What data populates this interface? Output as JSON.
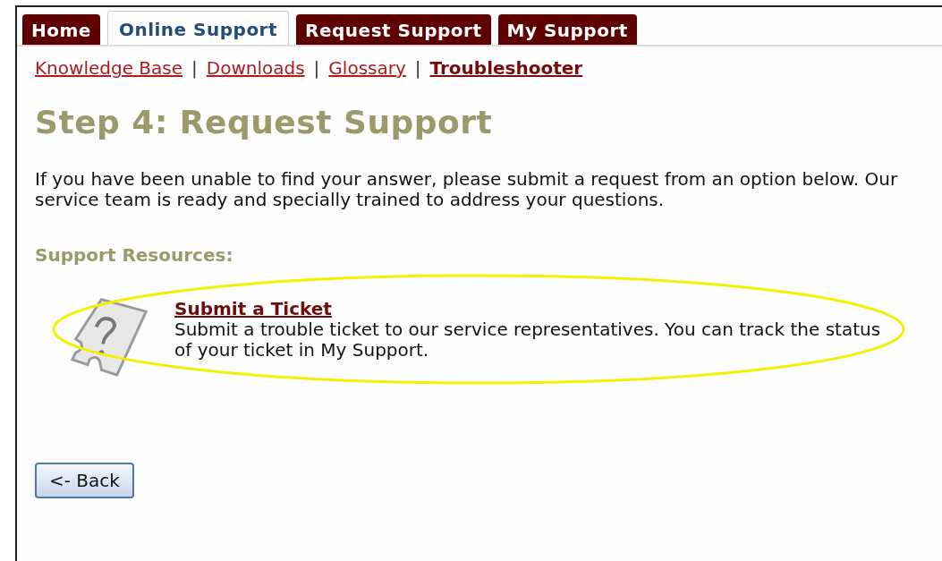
{
  "tabs": [
    {
      "label": "Home",
      "selected": false
    },
    {
      "label": "Online Support",
      "selected": true
    },
    {
      "label": "Request Support",
      "selected": false
    },
    {
      "label": "My Support",
      "selected": false
    }
  ],
  "subnav": {
    "separator": "|",
    "links": [
      {
        "label": "Knowledge Base",
        "selected": false
      },
      {
        "label": "Downloads",
        "selected": false
      },
      {
        "label": "Glossary",
        "selected": false
      },
      {
        "label": "Troubleshooter",
        "selected": true
      }
    ]
  },
  "heading": "Step 4: Request Support",
  "intro": "If you have been unable to find your answer, please submit a request from an option below. Our service team is ready and specially trained to address your questions.",
  "resources": {
    "title": "Support Resources:",
    "items": [
      {
        "title": "Submit a Ticket",
        "description": "Submit a trouble ticket to our service representatives. You can track the status of your ticket in My Support.",
        "highlighted": true
      }
    ]
  },
  "back_button": "<- Back"
}
